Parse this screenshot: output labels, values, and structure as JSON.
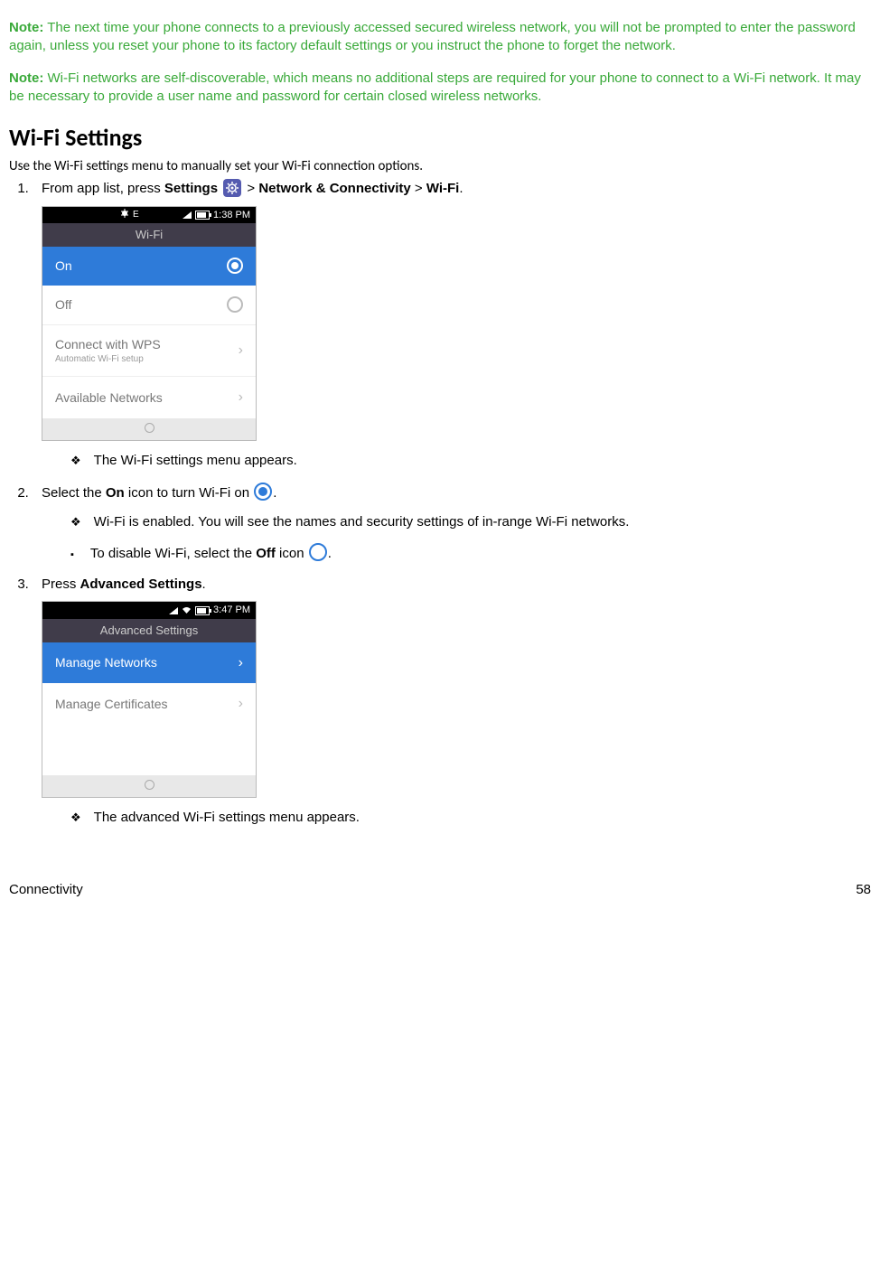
{
  "notes": {
    "n1_label": "Note:",
    "n1_text": " The next time your phone connects to a previously accessed secured wireless network, you will not be prompted to enter the password again, unless you reset your phone to its factory default settings or you instruct the phone to forget the network.",
    "n2_label": "Note:",
    "n2_text": " Wi-Fi networks are self-discoverable, which means no additional steps are required for your phone to connect to a Wi-Fi network. It may be necessary to provide a user name and password for certain closed wireless networks."
  },
  "heading": "Wi-Fi Settings",
  "intro": "Use the Wi-Fi settings menu to manually set your Wi-Fi connection options.",
  "steps": {
    "s1": {
      "pre": "From app list, press ",
      "b1": "Settings",
      "mid": " > ",
      "b2": "Network & Connectivity",
      "mid2": " > ",
      "b3": "Wi-Fi",
      "post": ".",
      "sub1": "The Wi-Fi settings menu appears."
    },
    "s2": {
      "pre": "Select the ",
      "b1": "On",
      "mid": " icon to turn Wi-Fi on ",
      "post": ".",
      "sub1": "Wi-Fi is enabled. You will see the names and security settings of in-range Wi-Fi networks.",
      "subsub_pre": "To disable Wi-Fi, select the ",
      "subsub_b": "Off",
      "subsub_mid": " icon ",
      "subsub_post": "."
    },
    "s3": {
      "pre": "Press ",
      "b1": "Advanced Settings",
      "post": ".",
      "sub1": "The advanced Wi-Fi settings menu appears."
    }
  },
  "phone1": {
    "time": "1:38 PM",
    "status_e": "E",
    "title": "Wi-Fi",
    "rows": {
      "on": "On",
      "off": "Off",
      "wps": "Connect with WPS",
      "wps_sub": "Automatic Wi-Fi setup",
      "avail": "Available Networks"
    }
  },
  "phone2": {
    "time": "3:47 PM",
    "title": "Advanced Settings",
    "rows": {
      "manage_net": "Manage Networks",
      "manage_cert": "Manage Certificates"
    }
  },
  "footer": {
    "section": "Connectivity",
    "page": "58"
  }
}
